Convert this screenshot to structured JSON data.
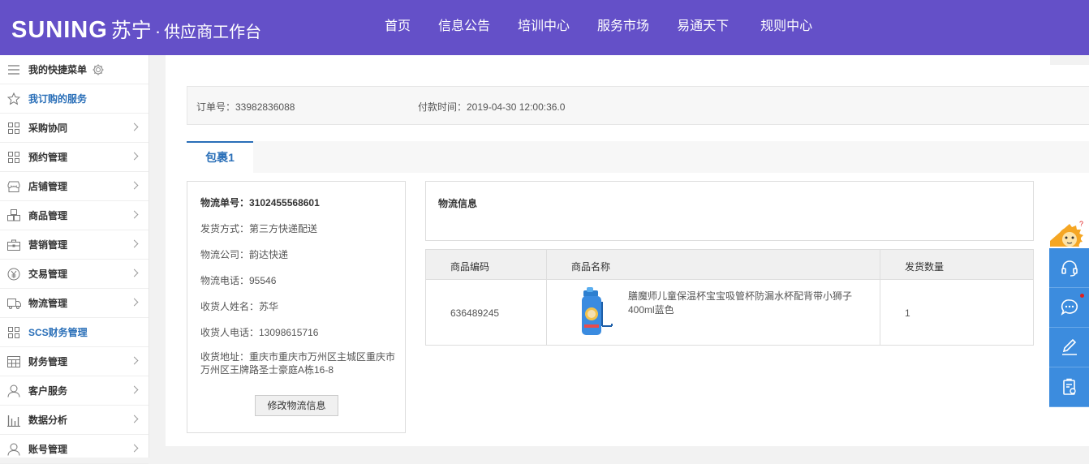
{
  "header": {
    "brand": "SUNING",
    "brand_cn": "苏宁",
    "dot": "·",
    "subtitle": "供应商工作台",
    "nav": [
      "首页",
      "信息公告",
      "培训中心",
      "服务市场",
      "易通天下",
      "规则中心"
    ]
  },
  "sidebar": {
    "items": [
      {
        "label": "我的快捷菜单",
        "icon": "menu-lines-icon"
      },
      {
        "label": "我订购的服务",
        "icon": "star-icon"
      },
      {
        "label": "采购协同",
        "icon": "grid-icon"
      },
      {
        "label": "预约管理",
        "icon": "grid-icon"
      },
      {
        "label": "店铺管理",
        "icon": "store-icon"
      },
      {
        "label": "商品管理",
        "icon": "boxes-icon"
      },
      {
        "label": "营销管理",
        "icon": "briefcase-icon"
      },
      {
        "label": "交易管理",
        "icon": "yen-icon"
      },
      {
        "label": "物流管理",
        "icon": "truck-icon"
      },
      {
        "label": "SCS财务管理",
        "icon": "grid-icon"
      },
      {
        "label": "财务管理",
        "icon": "ledger-icon"
      },
      {
        "label": "客户服务",
        "icon": "user-icon"
      },
      {
        "label": "数据分析",
        "icon": "bar-chart-icon"
      },
      {
        "label": "账号管理",
        "icon": "user-icon"
      }
    ]
  },
  "order": {
    "order_no": "订单号：33982836088",
    "pay_time": "付款时间：2019-04-30 12:00:36.0"
  },
  "tabs": [
    "包裹1"
  ],
  "shipping": {
    "tracking_label": "物流单号：",
    "tracking_no": "3102455568601",
    "method": "发货方式：第三方快递配送",
    "company": "物流公司：韵达快递",
    "phone": "物流电话：95546",
    "receiver": "收货人姓名：苏华",
    "receiver_phone": "收货人电话：13098615716",
    "address": "收货地址：重庆市重庆市万州区主城区重庆市万州区王牌路圣士豪庭A栋16-8",
    "edit_button": "修改物流信息"
  },
  "logistics": {
    "title": "物流信息"
  },
  "goods_table": {
    "headers": [
      "商品编码",
      "商品名称",
      "发货数量"
    ],
    "rows": [
      {
        "code": "636489245",
        "name": "膳魔师儿童保温杯宝宝吸管杯防漏水杯配背带小狮子400ml蓝色",
        "qty": "1"
      }
    ]
  },
  "float_tools": [
    "headset-icon",
    "chat-icon",
    "edit-icon",
    "clipboard-icon"
  ],
  "colors": {
    "header_bg": "#6450c8",
    "accent": "#2a6fb8",
    "float_bg": "#3c8cde"
  }
}
